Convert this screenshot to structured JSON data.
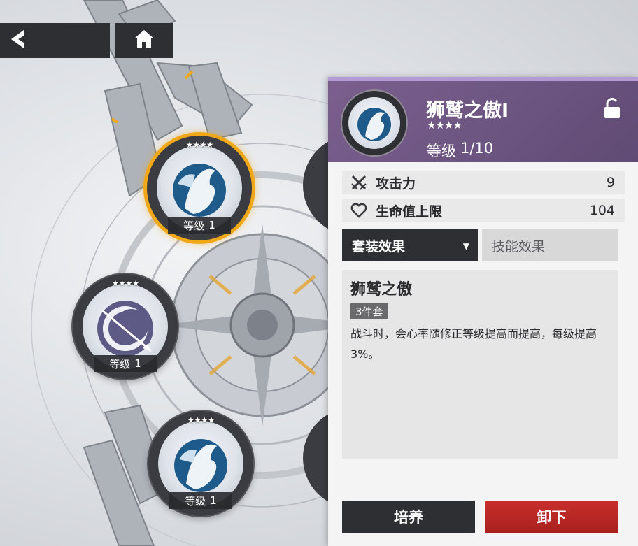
{
  "nav": {
    "back_icon": "chevron-left-icon",
    "home_icon": "home-icon"
  },
  "medallions": [
    {
      "stars": "★★★★",
      "level_label": "等级",
      "level": "1",
      "selected": true
    },
    {
      "stars": "★★★★",
      "level_label": "等级",
      "level": "1",
      "selected": false
    },
    {
      "stars": "★★★★",
      "level_label": "等级",
      "level": "1",
      "selected": false
    }
  ],
  "panel": {
    "name": "狮鹫之傲I",
    "stars": "★★★★",
    "level_label": "等级",
    "level": "1/10",
    "lock_icon": "unlock-icon",
    "stats": [
      {
        "icon": "crossed-swords-icon",
        "label": "攻击力",
        "value": "9"
      },
      {
        "icon": "heart-icon",
        "label": "生命值上限",
        "value": "104"
      }
    ],
    "tabs": {
      "set_effect": "套装效果",
      "skill_effect": "技能效果"
    },
    "effect": {
      "title": "狮鹫之傲",
      "badge": "3件套",
      "description": "战斗时，会心率随修正等级提高而提高，每级提高3%。"
    },
    "buttons": {
      "train": "培养",
      "unequip": "卸下"
    }
  },
  "colors": {
    "accent_gold": "#f0a818",
    "header_purple": "#6b5480",
    "danger_red": "#c9302c"
  }
}
